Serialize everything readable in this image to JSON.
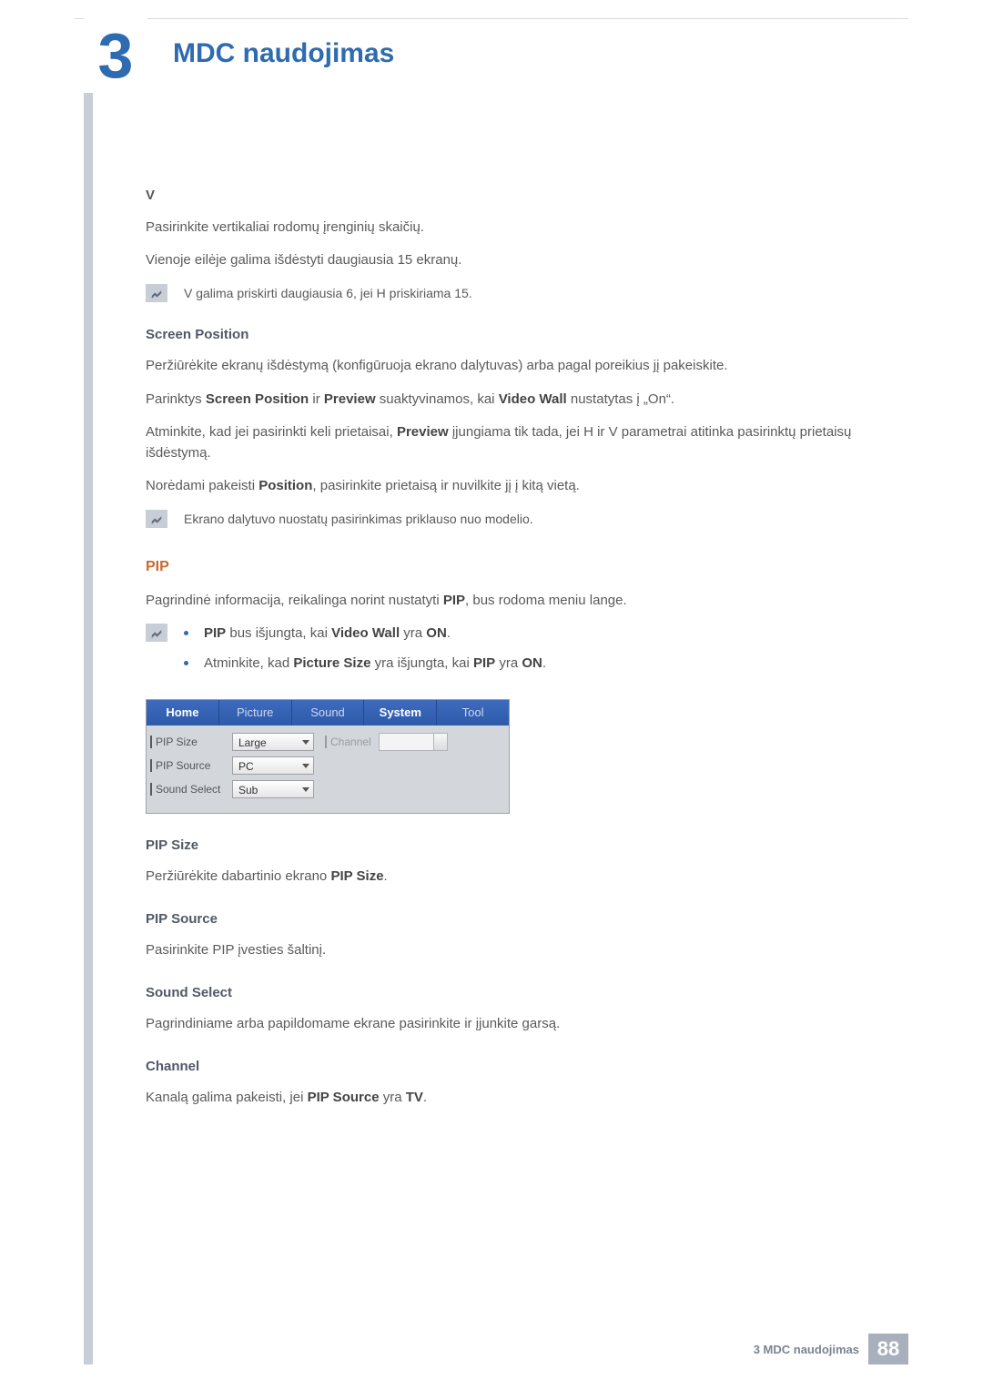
{
  "header": {
    "chapter_number": "3",
    "chapter_title": "MDC naudojimas"
  },
  "sections": {
    "v_title": "V",
    "v_p1": "Pasirinkite vertikaliai rodomų įrenginių skaičių.",
    "v_p2": "Vienoje eilėje galima išdėstyti daugiausia 15 ekranų.",
    "v_note": "V galima priskirti daugiausia 6, jei H priskiriama 15.",
    "sp_title": "Screen Position",
    "sp_p1": "Peržiūrėkite ekranų išdėstymą (konfigūruoja ekrano dalytuvas) arba pagal poreikius jį pakeiskite.",
    "sp_p2_a": "Parinktys ",
    "sp_p2_b": "Screen Position",
    "sp_p2_c": " ir ",
    "sp_p2_d": "Preview",
    "sp_p2_e": " suaktyvinamos, kai ",
    "sp_p2_f": "Video Wall",
    "sp_p2_g": " nustatytas į „On“.",
    "sp_p3_a": "Atminkite, kad jei pasirinkti keli prietaisai, ",
    "sp_p3_b": "Preview",
    "sp_p3_c": " įjungiama tik tada, jei H ir V parametrai atitinka pasirinktų prietaisų išdėstymą.",
    "sp_p4_a": "Norėdami pakeisti ",
    "sp_p4_b": "Position",
    "sp_p4_c": ", pasirinkite prietaisą ir nuvilkite jį į kitą vietą.",
    "sp_note": "Ekrano dalytuvo nuostatų pasirinkimas priklauso nuo modelio.",
    "pip_title": "PIP",
    "pip_intro_a": "Pagrindinė informacija, reikalinga norint nustatyti ",
    "pip_intro_b": "PIP",
    "pip_intro_c": ", bus rodoma meniu lange.",
    "pip_b1_a": "PIP",
    "pip_b1_b": " bus išjungta, kai ",
    "pip_b1_c": "Video Wall",
    "pip_b1_d": " yra ",
    "pip_b1_e": "ON",
    "pip_b1_f": ".",
    "pip_b2_a": "Atminkite, kad ",
    "pip_b2_b": "Picture Size",
    "pip_b2_c": " yra išjungta, kai ",
    "pip_b2_d": "PIP",
    "pip_b2_e": " yra ",
    "pip_b2_f": "ON",
    "pip_b2_g": ".",
    "pipsize_title": "PIP Size",
    "pipsize_p_a": "Peržiūrėkite dabartinio ekrano ",
    "pipsize_p_b": "PIP Size",
    "pipsize_p_c": ".",
    "pipsource_title": "PIP Source",
    "pipsource_p": "Pasirinkite PIP įvesties šaltinį.",
    "soundsel_title": "Sound Select",
    "soundsel_p": "Pagrindiniame arba papildomame ekrane pasirinkite ir įjunkite garsą.",
    "channel_title": "Channel",
    "channel_p_a": "Kanalą galima pakeisti, jei ",
    "channel_p_b": "PIP Source",
    "channel_p_c": " yra ",
    "channel_p_d": "TV",
    "channel_p_e": "."
  },
  "app": {
    "tabs": {
      "home": "Home",
      "picture": "Picture",
      "sound": "Sound",
      "system": "System",
      "tool": "Tool"
    },
    "rows": {
      "pipsize_label": "PIP Size",
      "pipsize_value": "Large",
      "channel_label": "Channel",
      "pipsource_label": "PIP Source",
      "pipsource_value": "PC",
      "soundselect_label": "Sound Select",
      "soundselect_value": "Sub"
    }
  },
  "footer": {
    "text": "3 MDC naudojimas",
    "page": "88"
  }
}
